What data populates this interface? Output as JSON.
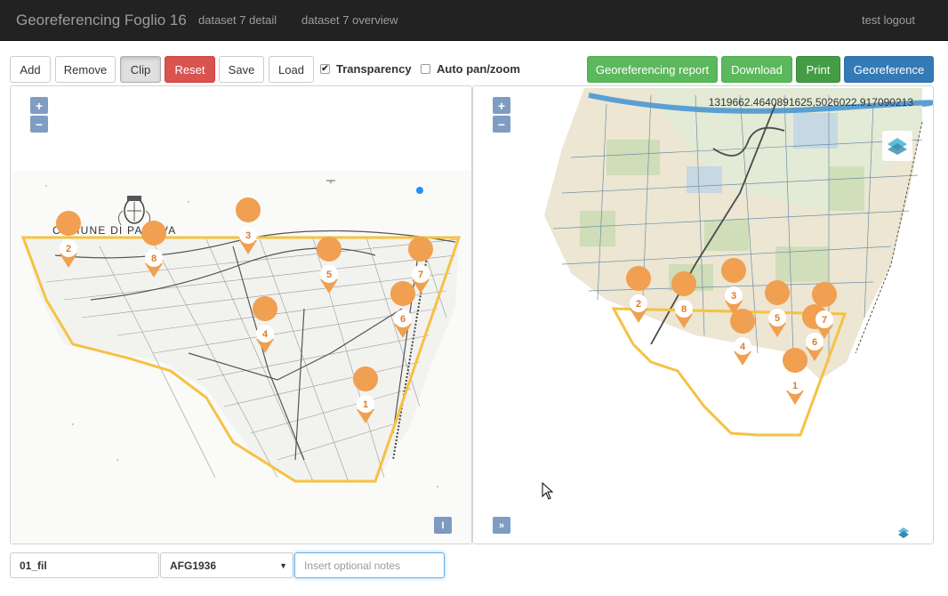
{
  "navbar": {
    "brand": "Georeferencing Foglio 16",
    "links": [
      "dataset 7 detail",
      "dataset 7 overview"
    ],
    "user": "test logout"
  },
  "toolbar": {
    "add": "Add",
    "remove": "Remove",
    "clip": "Clip",
    "reset": "Reset",
    "save": "Save",
    "load": "Load",
    "transparency": "Transparency",
    "transparency_checked": true,
    "auto_pan": "Auto pan/zoom",
    "auto_pan_checked": false,
    "report": "Georeferencing report",
    "download": "Download",
    "print": "Print",
    "georeference": "Georeference"
  },
  "left_map": {
    "zoom_in": "+",
    "zoom_out": "−",
    "map_title": "COMUNE DI PADOVA",
    "markers": [
      "1",
      "2",
      "3",
      "4",
      "5",
      "6",
      "7",
      "8"
    ],
    "corner_button": "I"
  },
  "right_map": {
    "zoom_in": "+",
    "zoom_out": "−",
    "coordinates": "1319662.4640891625,5026022.917090213",
    "markers": [
      "1",
      "2",
      "3",
      "4",
      "5",
      "6",
      "7",
      "8"
    ],
    "corner_button": "»"
  },
  "form": {
    "name_value": "01_fil",
    "crs_value": "AFG1936",
    "notes_placeholder": "Insert optional notes"
  },
  "colors": {
    "navbar": "#222222",
    "clip_line": "#f5c242",
    "marker": "#f0a050",
    "primary": "#337ab7",
    "success": "#5cb85c",
    "danger": "#d9534f"
  }
}
